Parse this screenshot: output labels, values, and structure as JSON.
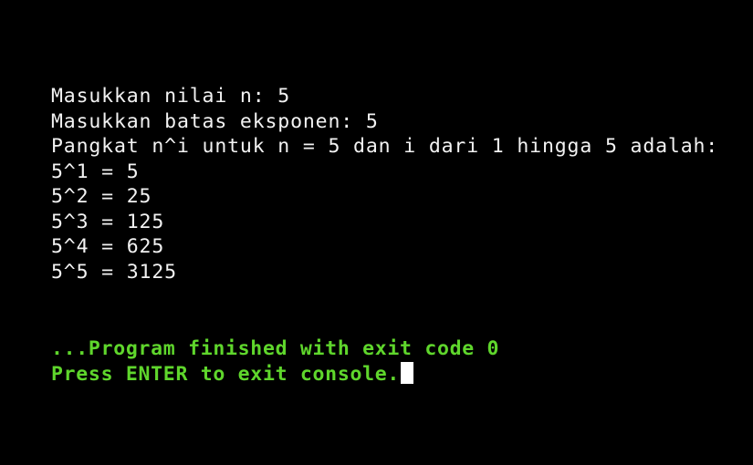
{
  "terminal": {
    "background_color": "#000000",
    "stdout_color": "#f2f2f2",
    "exit_message_color": "#5fd62c",
    "cursor_color": "#ffffff",
    "output_lines": [
      "Masukkan nilai n: 5",
      "Masukkan batas eksponen: 5",
      "Pangkat n^i untuk n = 5 dan i dari 1 hingga 5 adalah:",
      "5^1 = 5",
      "5^2 = 25",
      "5^3 = 125",
      "5^4 = 625",
      "5^5 = 3125"
    ],
    "prompts": {
      "input_n": "Masukkan nilai n: 5",
      "input_exponent_limit": "Masukkan batas eksponen: 5",
      "result_header": "Pangkat n^i untuk n = 5 dan i dari 1 hingga 5 adalah:"
    },
    "results": [
      {
        "expression": "5^1",
        "equals": "=",
        "value": "5",
        "text": "5^1 = 5"
      },
      {
        "expression": "5^2",
        "equals": "=",
        "value": "25",
        "text": "5^2 = 25"
      },
      {
        "expression": "5^3",
        "equals": "=",
        "value": "125",
        "text": "5^3 = 125"
      },
      {
        "expression": "5^4",
        "equals": "=",
        "value": "625",
        "text": "5^4 = 625"
      },
      {
        "expression": "5^5",
        "equals": "=",
        "value": "3125",
        "text": "5^5 = 3125"
      }
    ],
    "footer": {
      "finished_message": "...Program finished with exit code 0",
      "exit_code": "0",
      "press_enter_message": "Press ENTER to exit console.",
      "cursor": "block"
    }
  }
}
